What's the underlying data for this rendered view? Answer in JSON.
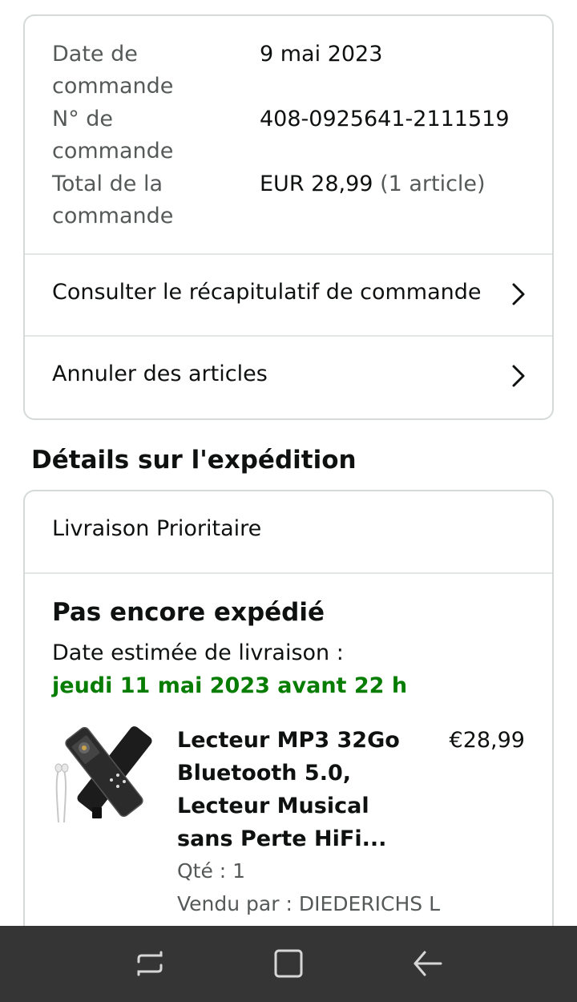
{
  "order": {
    "date_label": "Date de commande",
    "date_value": "9 mai 2023",
    "number_label": "N° de commande",
    "number_value": "408-0925641-2111519",
    "total_label": "Total de la commande",
    "total_value": "EUR 28,99",
    "total_count": "(1 article)"
  },
  "links": {
    "summary": "Consulter le récapitulatif de commande",
    "cancel": "Annuler des articles"
  },
  "shipping": {
    "section_title": "Détails sur l'expédition",
    "type": "Livraison Prioritaire",
    "status": "Pas encore expédié",
    "estimated_label": "Date estimée de livraison :",
    "estimated_date": "jeudi 11 mai 2023 avant 22 h"
  },
  "product": {
    "title": "Lecteur MP3 32Go Bluetooth 5.0, Lecteur Musical sans Perte HiFi...",
    "price": "€28,99",
    "quantity": "Qté : 1",
    "seller": "Vendu par : DIEDERICHS L"
  },
  "colors": {
    "delivery_green": "#067d00",
    "navbar": "#353535",
    "border": "#d5d9d9"
  },
  "icons": {
    "chevron": "chevron-right-icon",
    "nav_recents": "recent-apps-icon",
    "nav_home": "home-icon",
    "nav_back": "back-icon"
  }
}
